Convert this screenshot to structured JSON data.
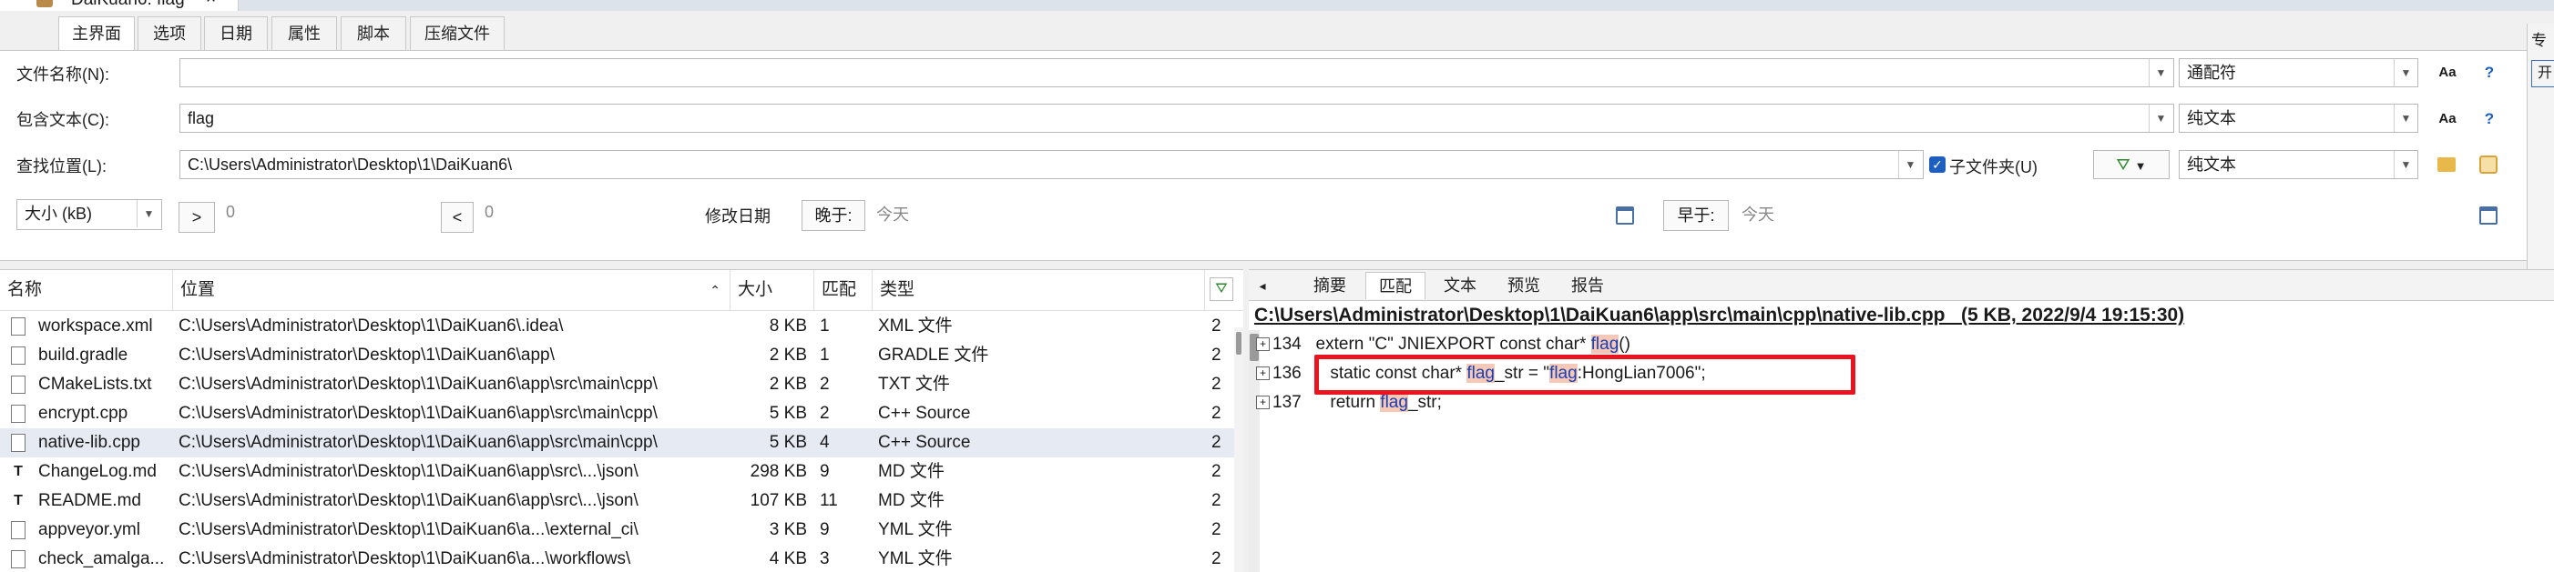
{
  "window": {
    "title": "DaiKuan6: flag",
    "close": "×"
  },
  "tabs": [
    "主界面",
    "选项",
    "日期",
    "属性",
    "脚本",
    "压缩文件"
  ],
  "search": {
    "filename_label": "文件名称(N):",
    "filename_value": "",
    "filename_mode": "通配符",
    "contains_label": "包含文本(C):",
    "contains_value": "flag",
    "contains_mode": "纯文本",
    "location_label": "查找位置(L):",
    "location_value": "C:\\Users\\Administrator\\Desktop\\1\\DaiKuan6\\",
    "subfolders_label": "子文件夹(U)",
    "subfolders_checked": true,
    "location_mode": "纯文本",
    "case_label": "Aa",
    "help_label": "?",
    "size_unit": "大小 (kB)",
    "gt_label": ">",
    "gt_value": "0",
    "lt_label": "<",
    "lt_value": "0",
    "modified_label": "修改日期",
    "later_label": "晚于:",
    "later_value": "今天",
    "earlier_label": "早于:",
    "earlier_value": "今天",
    "right_cut_top": "专",
    "right_cut_btn": "开"
  },
  "results": {
    "columns": {
      "name": "名称",
      "location": "位置",
      "size": "大小",
      "match": "匹配",
      "type": "类型"
    },
    "rows": [
      {
        "name": "workspace.xml",
        "location": "C:\\Users\\Administrator\\Desktop\\1\\DaiKuan6\\.idea\\",
        "size": "8 KB",
        "match": "1",
        "type": "XML 文件",
        "extra": "2",
        "icon": "file-icon"
      },
      {
        "name": "build.gradle",
        "location": "C:\\Users\\Administrator\\Desktop\\1\\DaiKuan6\\app\\",
        "size": "2 KB",
        "match": "1",
        "type": "GRADLE 文件",
        "extra": "2",
        "icon": "file-icon"
      },
      {
        "name": "CMakeLists.txt",
        "location": "C:\\Users\\Administrator\\Desktop\\1\\DaiKuan6\\app\\src\\main\\cpp\\",
        "size": "2 KB",
        "match": "2",
        "type": "TXT 文件",
        "extra": "2",
        "icon": "file-icon"
      },
      {
        "name": "encrypt.cpp",
        "location": "C:\\Users\\Administrator\\Desktop\\1\\DaiKuan6\\app\\src\\main\\cpp\\",
        "size": "5 KB",
        "match": "2",
        "type": "C++ Source",
        "extra": "2",
        "icon": "source-file-icon"
      },
      {
        "name": "native-lib.cpp",
        "location": "C:\\Users\\Administrator\\Desktop\\1\\DaiKuan6\\app\\src\\main\\cpp\\",
        "size": "5 KB",
        "match": "4",
        "type": "C++ Source",
        "extra": "2",
        "icon": "source-file-icon"
      },
      {
        "name": "ChangeLog.md",
        "location": "C:\\Users\\Administrator\\Desktop\\1\\DaiKuan6\\app\\src\\...\\json\\",
        "size": "298 KB",
        "match": "9",
        "type": "MD 文件",
        "extra": "2",
        "icon": "text-file-icon"
      },
      {
        "name": "README.md",
        "location": "C:\\Users\\Administrator\\Desktop\\1\\DaiKuan6\\app\\src\\...\\json\\",
        "size": "107 KB",
        "match": "11",
        "type": "MD 文件",
        "extra": "2",
        "icon": "text-file-icon"
      },
      {
        "name": "appveyor.yml",
        "location": "C:\\Users\\Administrator\\Desktop\\1\\DaiKuan6\\a...\\external_ci\\",
        "size": "3 KB",
        "match": "9",
        "type": "YML 文件",
        "extra": "2",
        "icon": "file-icon"
      },
      {
        "name": "check_amalga...",
        "location": "C:\\Users\\Administrator\\Desktop\\1\\DaiKuan6\\a...\\workflows\\",
        "size": "4 KB",
        "match": "3",
        "type": "YML 文件",
        "extra": "2",
        "icon": "file-icon"
      }
    ],
    "selected_index": 4
  },
  "preview": {
    "nav_prev": "◂",
    "tabs": [
      "摘要",
      "匹配",
      "文本",
      "预览",
      "报告"
    ],
    "active_tab": "匹配",
    "path": "C:\\Users\\Administrator\\Desktop\\1\\DaiKuan6\\app\\src\\main\\cpp\\native-lib.cpp",
    "meta": "(5 KB,  2022/9/4 19:15:30)",
    "lines": [
      {
        "num": "134",
        "pre": "   extern \"C\" JNIEXPORT const char* ",
        "hl": "flag",
        "post": "()"
      },
      {
        "num": "136",
        "pre": "      static const char* ",
        "hl": "flag",
        "mid": "_str = \"",
        "hl2": "flag",
        "post": ":HongLian7006\";"
      },
      {
        "num": "137",
        "pre": "      return ",
        "hl": "flag",
        "post": "_str;"
      }
    ]
  }
}
